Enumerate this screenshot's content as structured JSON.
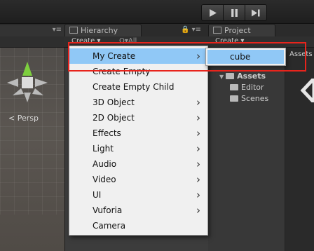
{
  "toolbar": {
    "play_icon": "play-icon",
    "pause_icon": "pause-icon",
    "step_icon": "step-icon"
  },
  "hierarchy": {
    "tab_label": "Hierarchy",
    "create_label": "Create ▾",
    "search_hint": "Q▾All"
  },
  "scene": {
    "persp_label": "< Persp"
  },
  "project": {
    "tab_label": "Project",
    "create_label": "Create ▾",
    "assets_crumb": "Assets",
    "tree": [
      {
        "label": "Assets"
      },
      {
        "label": "Editor"
      },
      {
        "label": "Scenes"
      }
    ]
  },
  "menu": {
    "items": [
      {
        "label": "My Create",
        "submenu": true
      },
      {
        "label": "Create Empty",
        "submenu": false
      },
      {
        "label": "Create Empty Child",
        "submenu": false
      },
      {
        "label": "3D Object",
        "submenu": true
      },
      {
        "label": "2D Object",
        "submenu": true
      },
      {
        "label": "Effects",
        "submenu": true
      },
      {
        "label": "Light",
        "submenu": true
      },
      {
        "label": "Audio",
        "submenu": true
      },
      {
        "label": "Video",
        "submenu": true
      },
      {
        "label": "UI",
        "submenu": true
      },
      {
        "label": "Vuforia",
        "submenu": true
      },
      {
        "label": "Camera",
        "submenu": false
      }
    ],
    "submenu": {
      "item": "cube"
    }
  },
  "colors": {
    "highlight": "#90c8f6",
    "annotation": "#e8241c"
  }
}
